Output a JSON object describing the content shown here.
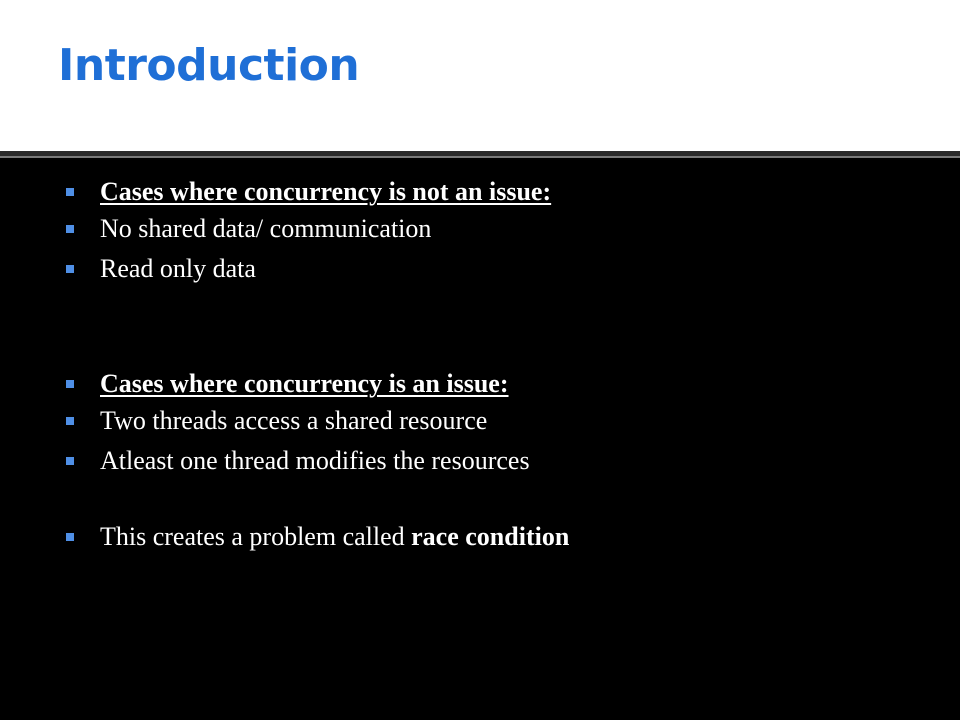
{
  "slide": {
    "title": "Introduction",
    "colors": {
      "title": "#1f6fd6",
      "bullet_marker": "#4f8fe6",
      "body_text": "#ffffff",
      "background": "#000000",
      "title_band": "#ffffff"
    },
    "bullet_marker_icon": "square-bullet-icon",
    "bullets": [
      {
        "text": "Cases where concurrency is not an issue:"
      },
      {
        "text": "No shared data/ communication"
      },
      {
        "text": "Read only data"
      },
      {
        "text": "Cases where concurrency is an issue:"
      },
      {
        "text": "Two threads access a shared resource"
      },
      {
        "text": "Atleast one thread modifies the resources"
      },
      {
        "text": "This creates a problem called ",
        "bold": "race condition"
      }
    ]
  }
}
